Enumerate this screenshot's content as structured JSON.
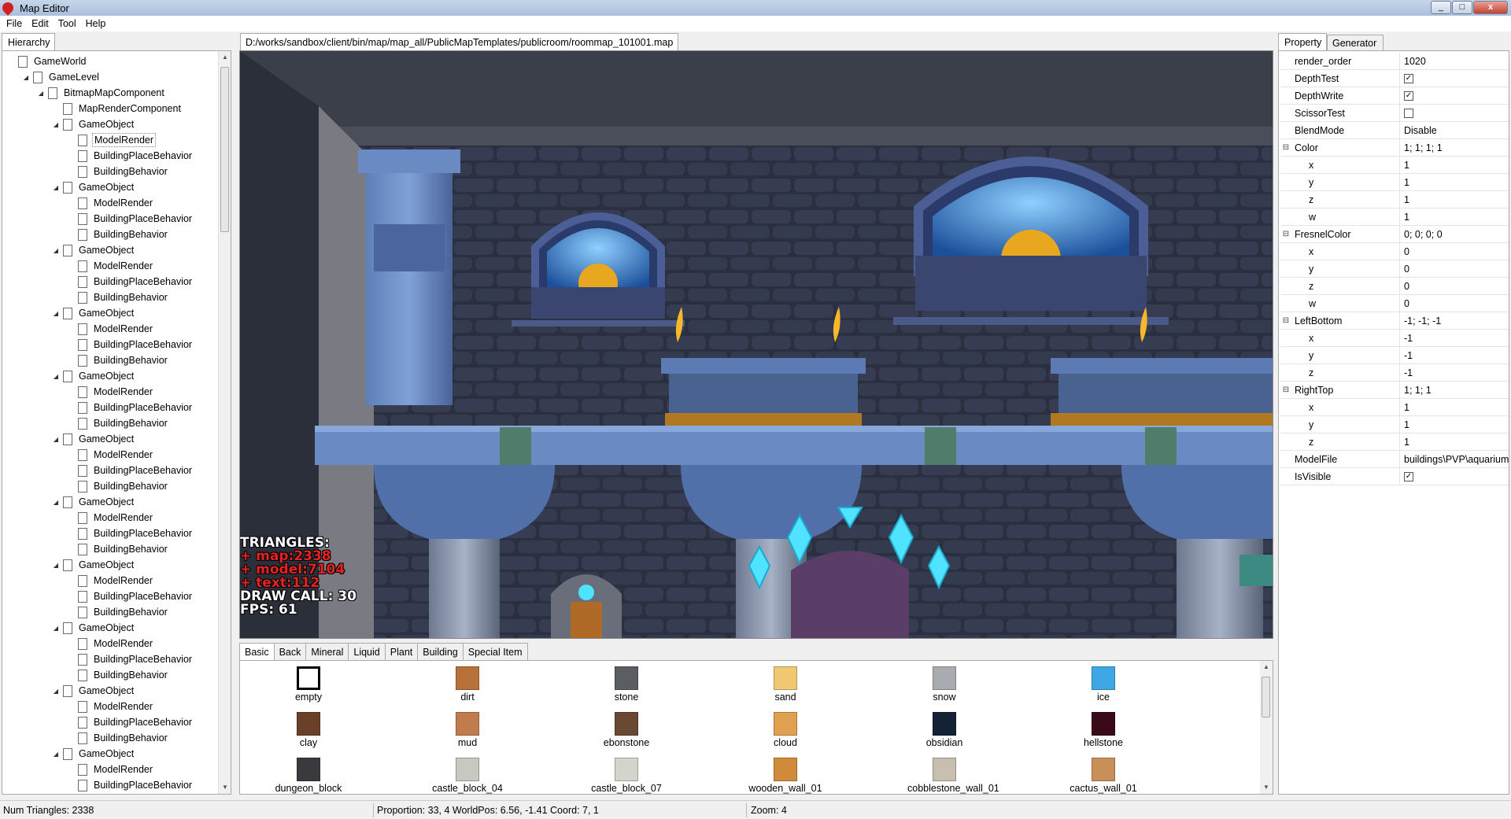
{
  "window": {
    "title": "Map Editor",
    "controls": [
      "_",
      "□",
      "x"
    ]
  },
  "menu": [
    "File",
    "Edit",
    "Tool",
    "Help"
  ],
  "hierarchy": {
    "tab_label": "Hierarchy",
    "root": "GameWorld",
    "level": "GameLevel",
    "bitmap": "BitmapMapComponent",
    "render": "MapRenderComponent",
    "object_label": "GameObject",
    "child_labels": [
      "ModelRender",
      "BuildingPlaceBehavior",
      "BuildingBehavior"
    ],
    "object_count": 11,
    "selected": "ModelRender"
  },
  "viewport": {
    "path": "D:/works/sandbox/client/bin/map/map_all/PublicMapTemplates/publicroom/roommap_101001.map",
    "stats": {
      "triangles": "TRIANGLES:",
      "map": "+ map:2338",
      "model": "+ model:7104",
      "text": "+ text:112",
      "draw_call": "DRAW CALL: 30",
      "fps": "FPS: 61"
    }
  },
  "palette": {
    "tabs": [
      "Basic",
      "Back",
      "Mineral",
      "Liquid",
      "Plant",
      "Building",
      "Special Item"
    ],
    "active_tab": "Basic",
    "items": [
      {
        "label": "empty",
        "color": "#ffffff"
      },
      {
        "label": "dirt",
        "color": "#b8713a"
      },
      {
        "label": "stone",
        "color": "#5a5e63"
      },
      {
        "label": "sand",
        "color": "#f0c872"
      },
      {
        "label": "snow",
        "color": "#a8abb0"
      },
      {
        "label": "ice",
        "color": "#3fa7e6"
      },
      {
        "label": "clay",
        "color": "#6a4028"
      },
      {
        "label": "mud",
        "color": "#c07c4c"
      },
      {
        "label": "ebonstone",
        "color": "#6a4832"
      },
      {
        "label": "cloud",
        "color": "#e0a050"
      },
      {
        "label": "obsidian",
        "color": "#142236"
      },
      {
        "label": "hellstone",
        "color": "#3a0a18"
      },
      {
        "label": "dungeon_block",
        "color": "#3a3a3e"
      },
      {
        "label": "castle_block_04",
        "color": "#c8c8c0"
      },
      {
        "label": "castle_block_07",
        "color": "#d4d4cc"
      },
      {
        "label": "wooden_wall_01",
        "color": "#d08a3a"
      },
      {
        "label": "cobblestone_wall_01",
        "color": "#c8bfb0"
      },
      {
        "label": "cactus_wall_01",
        "color": "#c89058"
      }
    ]
  },
  "properties": {
    "tabs": [
      "Property",
      "Generator"
    ],
    "rows": [
      {
        "name": "render_order",
        "value": "1020"
      },
      {
        "name": "DepthTest",
        "check": true
      },
      {
        "name": "DepthWrite",
        "check": true
      },
      {
        "name": "ScissorTest",
        "check": false
      },
      {
        "name": "BlendMode",
        "value": "Disable"
      },
      {
        "name": "Color",
        "value": "1; 1; 1; 1",
        "group": true
      },
      {
        "name": "x",
        "value": "1",
        "child": true
      },
      {
        "name": "y",
        "value": "1",
        "child": true
      },
      {
        "name": "z",
        "value": "1",
        "child": true
      },
      {
        "name": "w",
        "value": "1",
        "child": true
      },
      {
        "name": "FresnelColor",
        "value": "0; 0; 0; 0",
        "group": true
      },
      {
        "name": "x",
        "value": "0",
        "child": true
      },
      {
        "name": "y",
        "value": "0",
        "child": true
      },
      {
        "name": "z",
        "value": "0",
        "child": true
      },
      {
        "name": "w",
        "value": "0",
        "child": true
      },
      {
        "name": "LeftBottom",
        "value": "-1; -1; -1",
        "group": true
      },
      {
        "name": "x",
        "value": "-1",
        "child": true
      },
      {
        "name": "y",
        "value": "-1",
        "child": true
      },
      {
        "name": "z",
        "value": "-1",
        "child": true
      },
      {
        "name": "RightTop",
        "value": "1; 1; 1",
        "group": true
      },
      {
        "name": "x",
        "value": "1",
        "child": true
      },
      {
        "name": "y",
        "value": "1",
        "child": true
      },
      {
        "name": "z",
        "value": "1",
        "child": true
      },
      {
        "name": "ModelFile",
        "value": "buildings\\PVP\\aquarium"
      },
      {
        "name": "IsVisible",
        "check": true
      }
    ]
  },
  "status": {
    "triangles": "Num Triangles: 2338",
    "position": "Proportion: 33, 4 WorldPos: 6.56, -1.41 Coord: 7, 1",
    "zoom": "Zoom: 4"
  }
}
